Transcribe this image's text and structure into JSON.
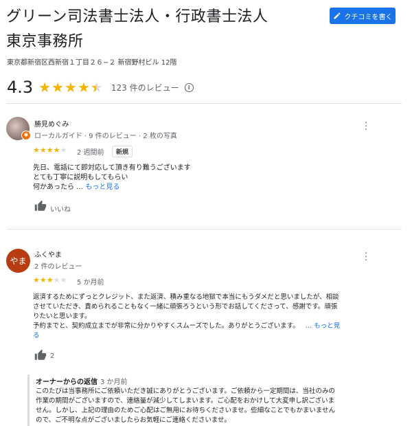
{
  "header": {
    "title_line1": "グリーン司法書士法人・行政書士法人",
    "title_line2": "東京事務所",
    "address": "東京都新宿区西新宿１丁目２６−２ 新宿野村ビル 12階",
    "write_review_label": "クチコミを書く"
  },
  "rating": {
    "value": "4.3",
    "stars": 4.3,
    "count_label": "123 件のレビュー",
    "info_glyph": "i"
  },
  "reviews": [
    {
      "name": "勝見めぐみ",
      "meta": "ローカルガイド · 9 件のレビュー · 2 枚の写真",
      "stars": 4,
      "time": "2 週間前",
      "tag": "新規",
      "lines": [
        "先日、電話にて即対応して頂き有り難うございます",
        "とても丁寧に説明もしてもらい"
      ],
      "last_line": "何かあったら …",
      "more_label": "もっと見る",
      "like_label": "いいね",
      "badge_glyph": "✱"
    },
    {
      "name": "ふくやま",
      "avatar_text": "やま",
      "meta": "2 件のレビュー",
      "stars": 3,
      "time": "5 か月前",
      "lines": [
        "返済するためにずっとクレジット、また返済、積み重なる地獄で本当にもうダメだと思いましたが、相談",
        "させていただき、責められることもなく一緒に頑張ろうという形でお話してくださって、感謝です。頑張",
        "りたいと思います。",
        "予約までと、契約成立までが非常に分かりやすくスムーズでした。ありがとうございます。"
      ],
      "trail": "…",
      "more_label_1": "もっと見",
      "more_label_2": "る",
      "like_count": "2"
    }
  ],
  "owner_reply": {
    "title": "オーナーからの返信",
    "time": "3 か月前",
    "lines": [
      "このたびは当事務所にご依頼いただき誠にありがとうございます。ご依頼から一定期間は、当社のみの",
      "作業の期間がございますので、連絡量が減少してしまいます。ご心配をおかけして大変申し訳ございま",
      "せん。しかし、上記の理由のためご心配はご無用にお待ちくださいませ。些細なことでもかまいません",
      "ので、ご不明な点がございましたらお気軽にご連絡くださいませ。"
    ]
  },
  "colors": {
    "accent": "#1a73e8",
    "star": "#f4b400",
    "avatar2": "#b83c12"
  }
}
